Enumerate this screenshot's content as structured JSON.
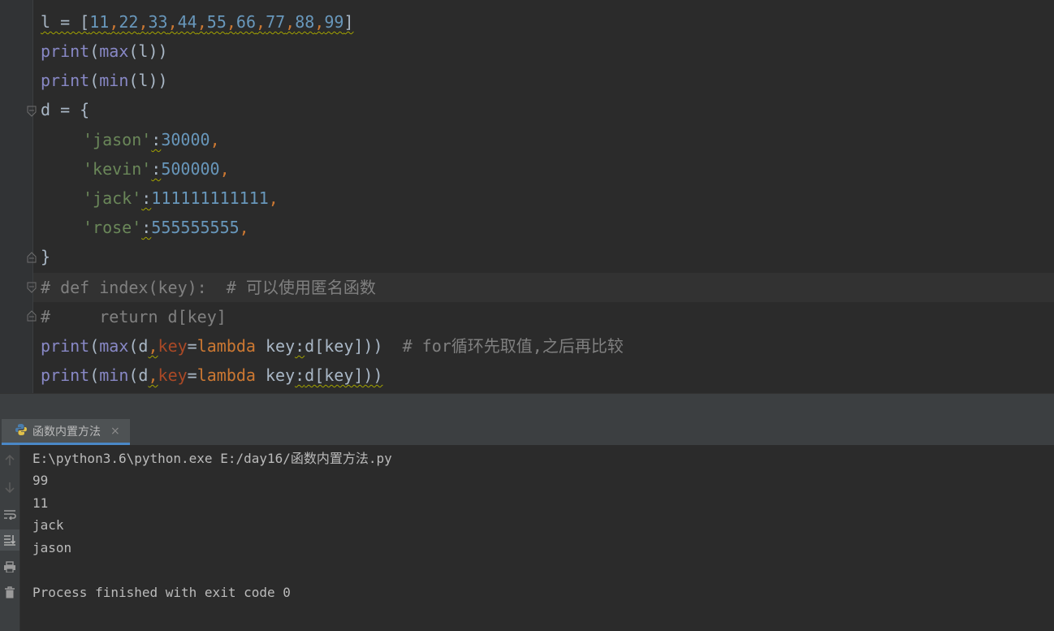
{
  "editor": {
    "lines": {
      "l1_var": "l = [",
      "l1_nums": [
        "11",
        "22",
        "33",
        "44",
        "55",
        "66",
        "77",
        "88",
        "99"
      ],
      "l1_end": "]",
      "l2_fn": "print",
      "l2_rest_a": "(",
      "l2_max": "max",
      "l2_rest_b": "(l))",
      "l3_fn": "print",
      "l3_rest_a": "(",
      "l3_min": "min",
      "l3_rest_b": "(l))",
      "l4": "d = {",
      "l5_str": "'jason'",
      "l5_colon": ":",
      "l5_num": "30000",
      "l6_str": "'kevin'",
      "l6_colon": ":",
      "l6_num": "500000",
      "l7_str": "'jack'",
      "l7_colon": ":",
      "l7_num": "111111111111",
      "l8_str": "'rose'",
      "l8_colon": ":",
      "l8_num": "555555555",
      "comma": ",",
      "l9": "}",
      "l10": "# def index(key):  # 可以使用匿名函数",
      "l11": "#     return d[key]",
      "l12_print": "print",
      "l12_a": "(",
      "l12_max": "max",
      "l12_b": "(d",
      "l12_comma": ",",
      "l12_key": "key",
      "l12_eq": "=",
      "l12_lambda": "lambda",
      "l12_c": " key",
      "l12_colon": ":",
      "l12_d": "d[key]))",
      "l12_cmt": "  # for循环先取值,之后再比较",
      "l13_print": "print",
      "l13_a": "(",
      "l13_min": "min",
      "l13_b": "(d",
      "l13_comma": ",",
      "l13_key": "key",
      "l13_eq": "=",
      "l13_lambda": "lambda",
      "l13_c": " key",
      "l13_colon": ":",
      "l13_d": "d[key]))"
    }
  },
  "run_panel": {
    "tab_label": "函数内置方法",
    "close": "×",
    "output": [
      "E:\\python3.6\\python.exe E:/day16/函数内置方法.py",
      "99",
      "11",
      "jack",
      "jason",
      "",
      "Process finished with exit code 0"
    ]
  },
  "icons": {
    "python": "python-icon",
    "up": "arrow-up-icon",
    "down": "arrow-down-icon",
    "wrap": "soft-wrap-icon",
    "scroll": "scroll-to-end-icon",
    "print": "print-icon",
    "trash": "trash-icon"
  }
}
